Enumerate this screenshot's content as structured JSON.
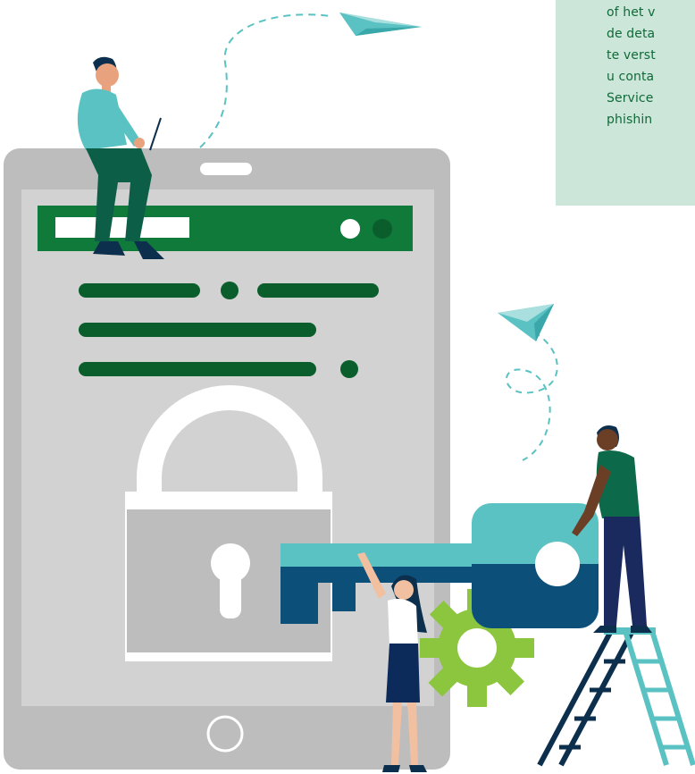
{
  "info_panel": {
    "lines": [
      "of het v",
      "de deta",
      "te verst",
      "u conta",
      "Service",
      "phishin"
    ]
  },
  "colors": {
    "tablet_frame": "#bdbdbd",
    "screen": "#d2d2d2",
    "brand_green": "#0f7a3a",
    "dark_green": "#0a5e2c",
    "teal": "#5bc2c3",
    "navy_blue": "#0c4f79",
    "gear_green": "#8cc63f",
    "info_panel_bg": "#cde6da",
    "info_panel_text": "#0f6a38"
  },
  "icons": [
    "lock-icon",
    "key-icon",
    "gear-icon",
    "paper-plane-icon",
    "home-button-icon",
    "ladder-icon"
  ]
}
